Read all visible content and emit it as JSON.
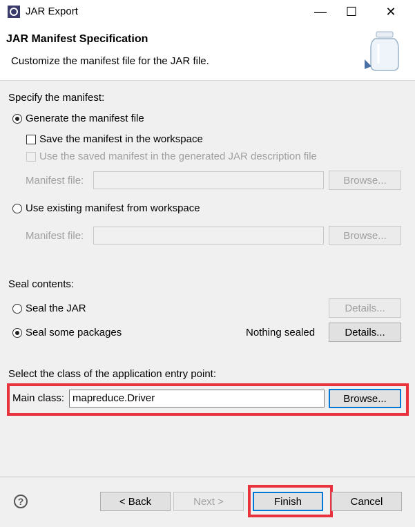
{
  "window": {
    "title": "JAR Export",
    "minimize": "—",
    "maximize": "☐",
    "close": "✕"
  },
  "header": {
    "title": "JAR Manifest Specification",
    "description": "Customize the manifest file for the JAR file."
  },
  "manifest": {
    "section_label": "Specify the manifest:",
    "generate_label": "Generate the manifest file",
    "save_label": "Save the manifest in the workspace",
    "use_saved_label": "Use the saved manifest in the generated JAR description file",
    "manifest_file_label": "Manifest file:",
    "browse_label": "Browse...",
    "use_existing_label": "Use existing manifest from workspace",
    "manifest_file_label2": "Manifest file:",
    "browse_label2": "Browse..."
  },
  "seal": {
    "section_label": "Seal contents:",
    "seal_jar_label": "Seal the JAR",
    "details_label": "Details...",
    "seal_some_label": "Seal some packages",
    "status": "Nothing sealed",
    "details_label2": "Details..."
  },
  "entry": {
    "section_label": "Select the class of the application entry point:",
    "main_class_label": "Main class:",
    "main_class_value": "mapreduce.Driver",
    "browse_label": "Browse..."
  },
  "footer": {
    "help": "?",
    "back": "< Back",
    "next": "Next >",
    "finish": "Finish",
    "cancel": "Cancel"
  },
  "colors": {
    "highlight": "#e8323c",
    "focus": "#0078d7"
  }
}
